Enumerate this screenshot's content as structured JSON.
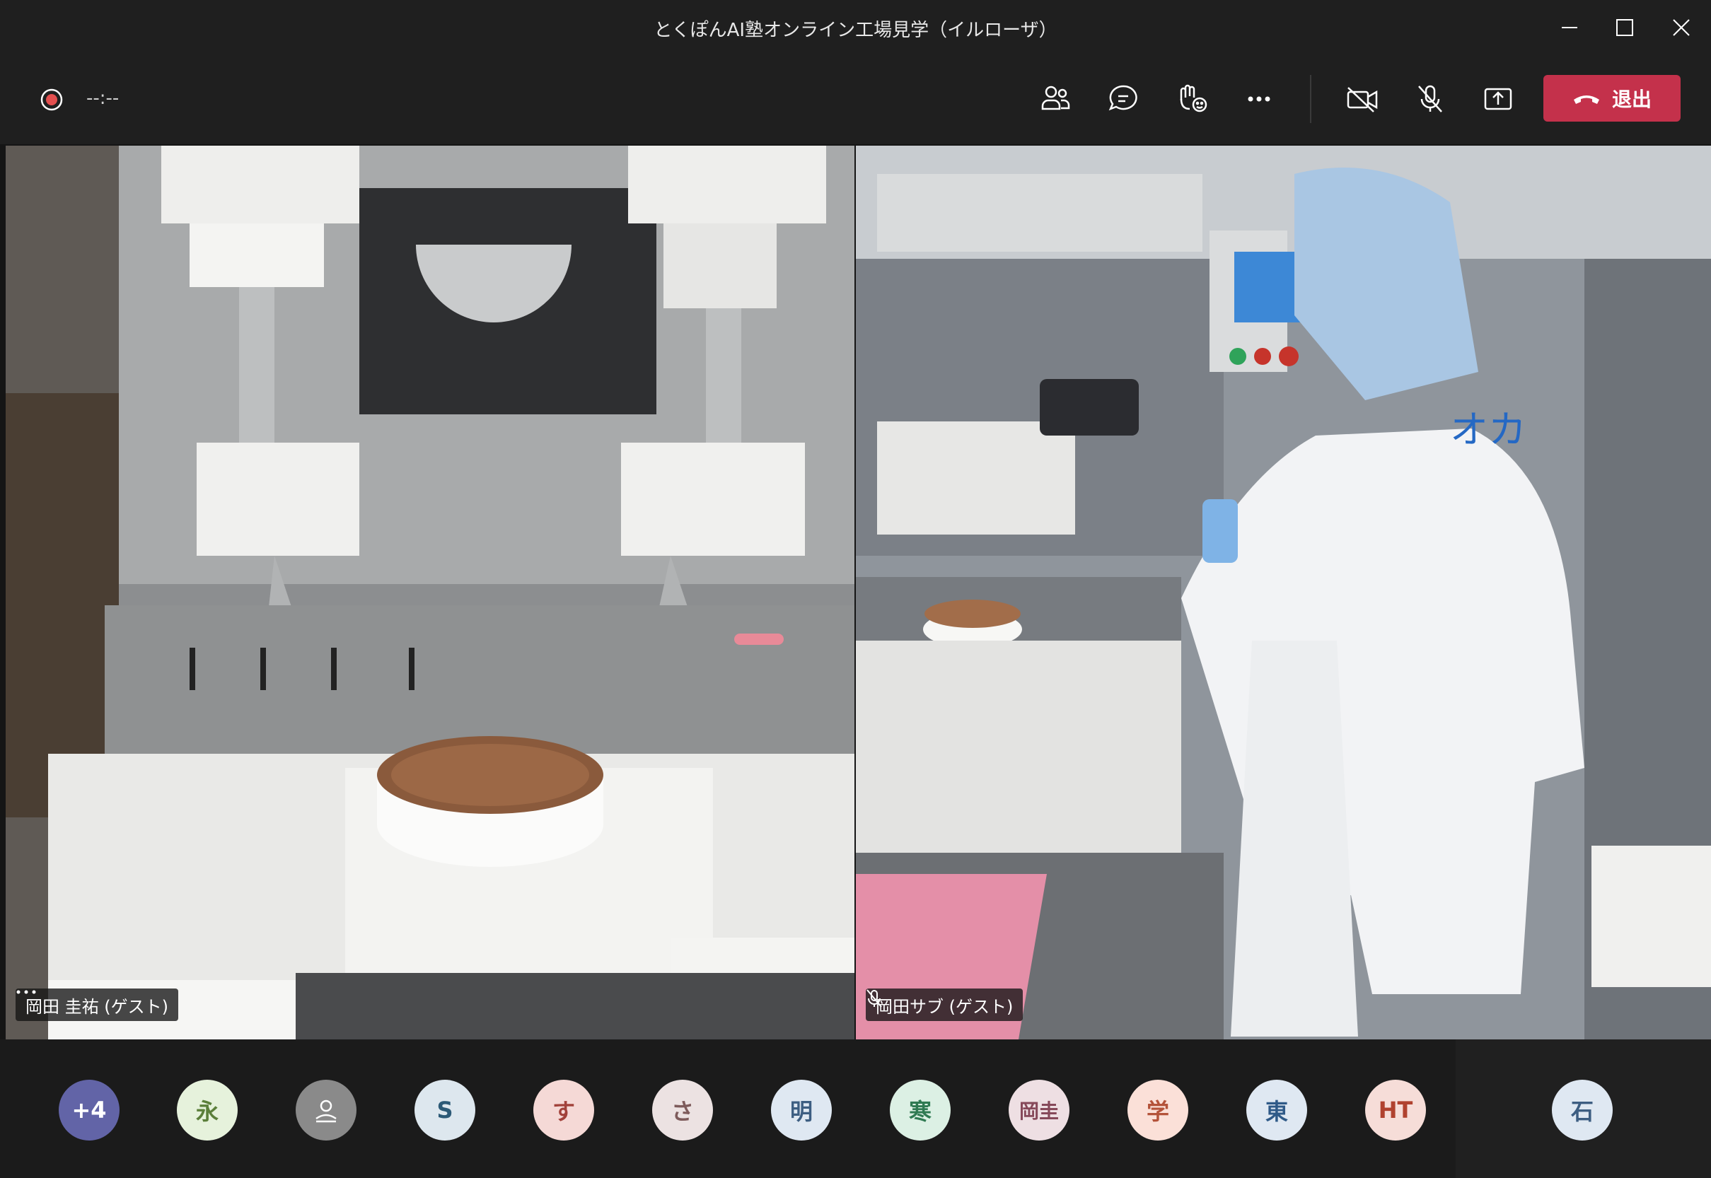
{
  "window": {
    "title": "とくぽんAI塾オンライン工場見学（イルローザ）"
  },
  "toolbar": {
    "timer": "--:--",
    "leave_label": "退出"
  },
  "colors": {
    "leave": "#c4314b",
    "record": "#e34f4f"
  },
  "participants_video": [
    {
      "name": "岡田 圭祐 (ゲスト)",
      "has_more": true,
      "muted": false
    },
    {
      "name": "岡田サブ (ゲスト)",
      "has_more": false,
      "muted": true
    }
  ],
  "roster": [
    {
      "label": "+4",
      "bg": "#6264a7",
      "fg": "#ffffff"
    },
    {
      "label": "永",
      "bg": "#e6f2dc",
      "fg": "#5b7f3a"
    },
    {
      "label": "",
      "bg": "#8a8a8a",
      "fg": "#ffffff",
      "icon": "person-icon"
    },
    {
      "label": "S",
      "bg": "#dde7ee",
      "fg": "#2c5a77"
    },
    {
      "label": "す",
      "bg": "#f5d9d6",
      "fg": "#a1413a"
    },
    {
      "label": "さ",
      "bg": "#ece2e2",
      "fg": "#7e5b5b"
    },
    {
      "label": "明",
      "bg": "#dfe8f2",
      "fg": "#3d5e82"
    },
    {
      "label": "寒",
      "bg": "#dcf0e4",
      "fg": "#2f7a52"
    },
    {
      "label": "岡圭",
      "bg": "#eedfe3",
      "fg": "#86495a"
    },
    {
      "label": "学",
      "bg": "#fbe0d8",
      "fg": "#b4533a"
    },
    {
      "label": "東",
      "bg": "#dfe8f2",
      "fg": "#2f5a88"
    },
    {
      "label": "HT",
      "bg": "#f6ddd8",
      "fg": "#b0422f"
    },
    {
      "label": "石",
      "bg": "#dfe8f2",
      "fg": "#3d5e82"
    }
  ]
}
